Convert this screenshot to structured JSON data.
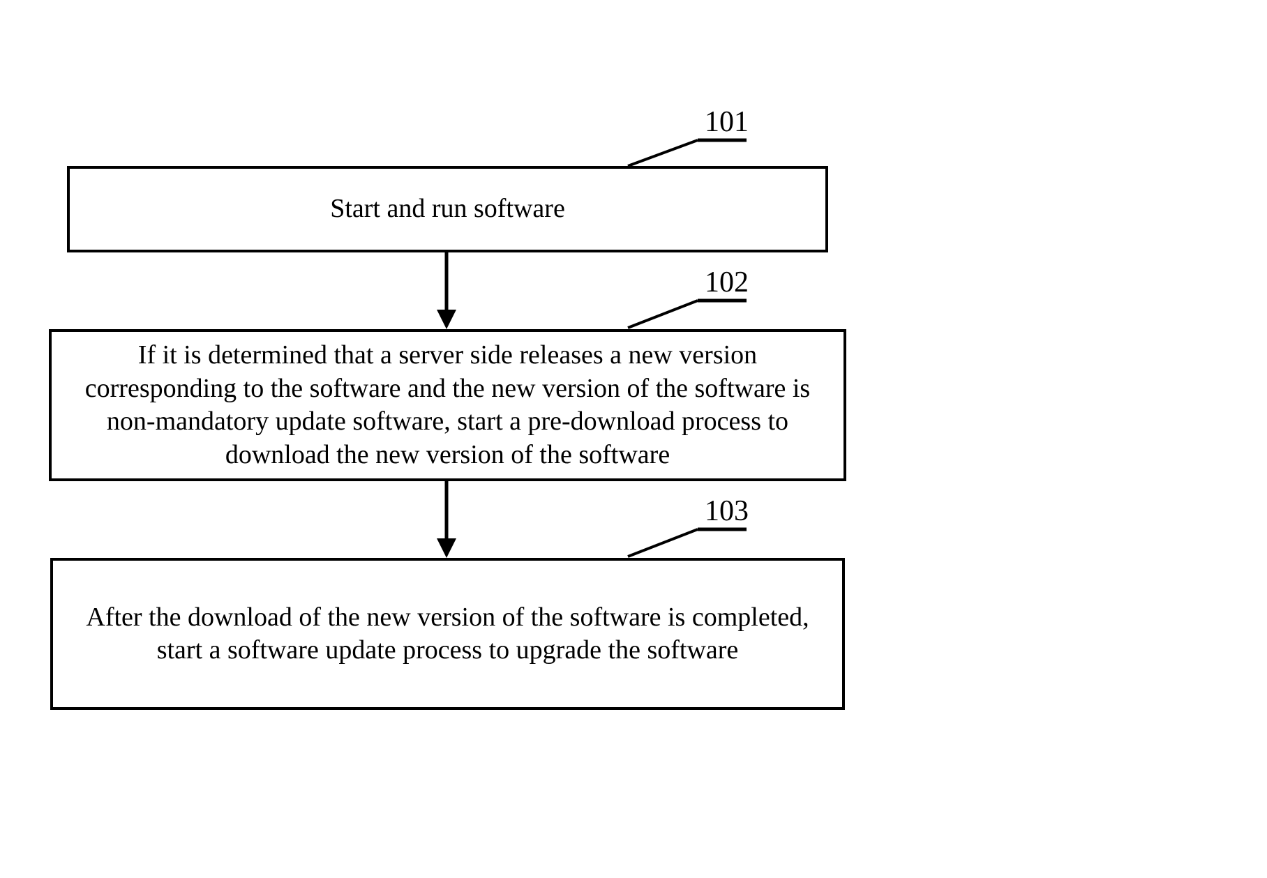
{
  "steps": {
    "s1": {
      "label": "101",
      "text": "Start and run software"
    },
    "s2": {
      "label": "102",
      "text": "If it is determined that a server side releases a new version corresponding to the software and the new version of the software is non-mandatory update software, start a pre-download process to download the new version of the software"
    },
    "s3": {
      "label": "103",
      "text": "After the download of the new version of the software is completed, start a software update process to upgrade the software"
    }
  }
}
